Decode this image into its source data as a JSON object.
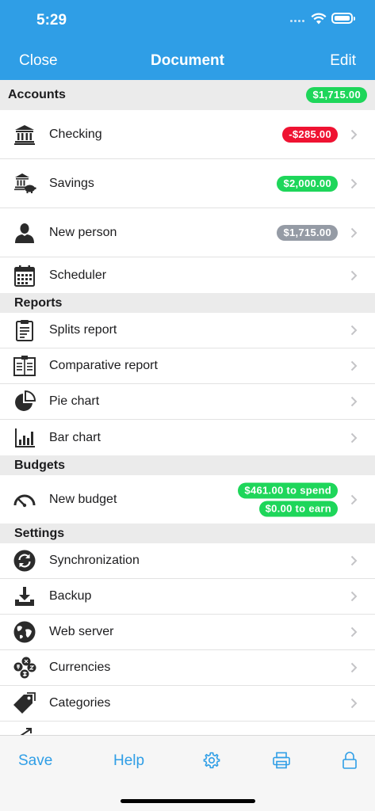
{
  "status": {
    "time": "5:29"
  },
  "nav": {
    "close": "Close",
    "title": "Document",
    "edit": "Edit"
  },
  "accounts": {
    "header": "Accounts",
    "total": "$1,715.00",
    "items": [
      {
        "label": "Checking",
        "amount": "-$285.00",
        "icon": "bank-icon"
      },
      {
        "label": "Savings",
        "amount": "$2,000.00",
        "icon": "piggy-bank-icon"
      },
      {
        "label": "New person",
        "amount": "$1,715.00",
        "icon": "person-icon"
      },
      {
        "label": "Scheduler",
        "icon": "calendar-icon"
      }
    ]
  },
  "reports": {
    "header": "Reports",
    "items": [
      {
        "label": "Splits report",
        "icon": "clipboard-icon"
      },
      {
        "label": "Comparative report",
        "icon": "compare-report-icon"
      },
      {
        "label": "Pie chart",
        "icon": "pie-chart-icon"
      },
      {
        "label": "Bar chart",
        "icon": "bar-chart-icon"
      }
    ]
  },
  "budgets": {
    "header": "Budgets",
    "items": [
      {
        "label": "New budget",
        "spend": "$461.00 to spend",
        "earn": "$0.00 to earn",
        "icon": "gauge-icon"
      }
    ]
  },
  "settings": {
    "header": "Settings",
    "items": [
      {
        "label": "Synchronization",
        "icon": "sync-icon"
      },
      {
        "label": "Backup",
        "icon": "download-icon"
      },
      {
        "label": "Web server",
        "icon": "globe-icon"
      },
      {
        "label": "Currencies",
        "icon": "coins-icon"
      },
      {
        "label": "Categories",
        "icon": "tag-icon"
      }
    ]
  },
  "toolbar": {
    "save": "Save",
    "help": "Help",
    "icons": [
      "gear-icon",
      "printer-icon",
      "lock-icon"
    ]
  },
  "colors": {
    "accent": "#2f9ee6",
    "positive": "#1ed65a",
    "negative": "#ef1332",
    "neutral": "#959ba5"
  }
}
